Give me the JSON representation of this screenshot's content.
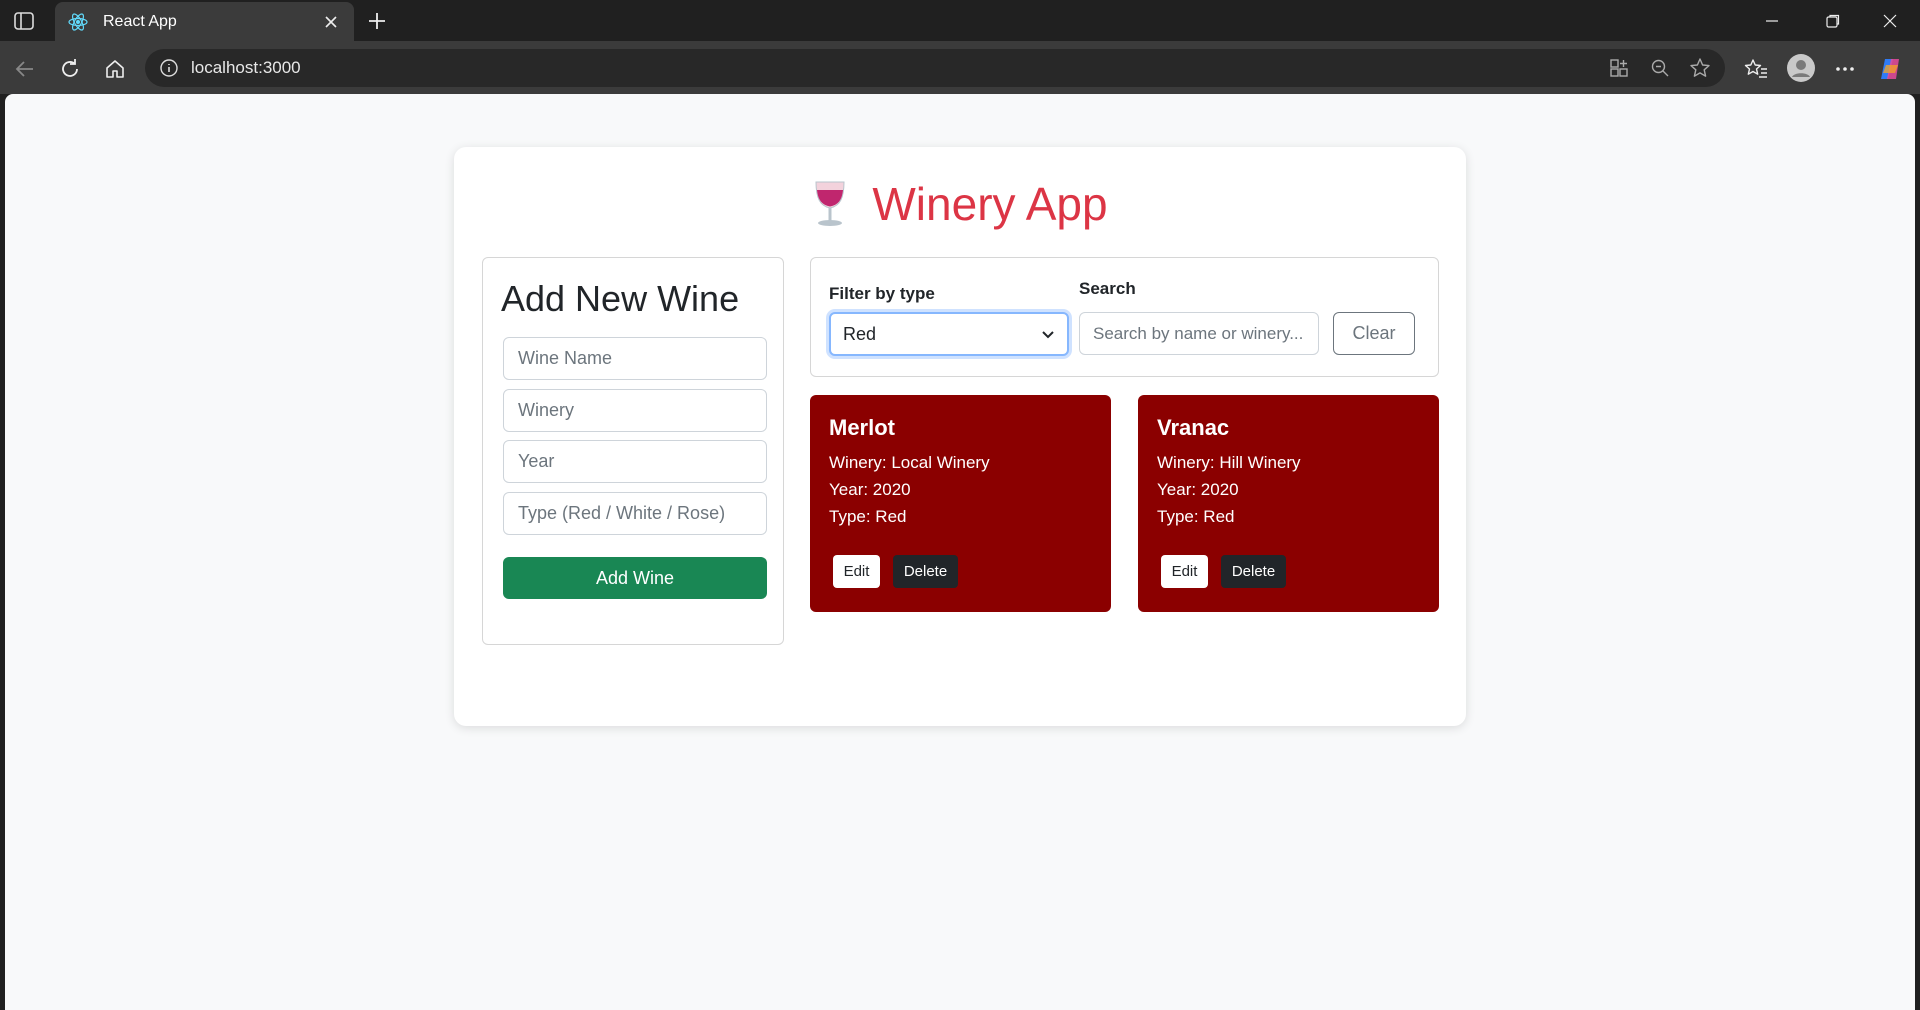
{
  "browser": {
    "tab_title": "React App",
    "url": "localhost:3000",
    "icons": [
      "sidebar-toggle-icon",
      "react-favicon-icon",
      "close-icon",
      "plus-icon",
      "minimize-icon",
      "restore-icon",
      "close-window-icon",
      "back-icon",
      "refresh-icon",
      "home-icon",
      "info-icon",
      "app-available-icon",
      "zoom-out-icon",
      "star-icon",
      "favorites-icon",
      "profile-icon",
      "more-icon",
      "copilot-icon"
    ]
  },
  "app": {
    "title": "Winery App",
    "title_color": "#dc3545",
    "form": {
      "heading": "Add New Wine",
      "name_placeholder": "Wine Name",
      "winery_placeholder": "Winery",
      "year_placeholder": "Year",
      "type_placeholder": "Type (Red / White / Rose)",
      "submit_label": "Add Wine",
      "submit_color": "#198754"
    },
    "filter": {
      "filter_label": "Filter by type",
      "selected_type": "Red",
      "search_label": "Search",
      "search_placeholder": "Search by name or winery...",
      "clear_label": "Clear"
    },
    "wines": [
      {
        "name": "Merlot",
        "winery": "Winery: Local Winery",
        "year": "Year: 2020",
        "type": "Type: Red",
        "edit_label": "Edit",
        "delete_label": "Delete"
      },
      {
        "name": "Vranac",
        "winery": "Winery: Hill Winery",
        "year": "Year: 2020",
        "type": "Type: Red",
        "edit_label": "Edit",
        "delete_label": "Delete"
      }
    ],
    "card_color": "#8b0000"
  }
}
